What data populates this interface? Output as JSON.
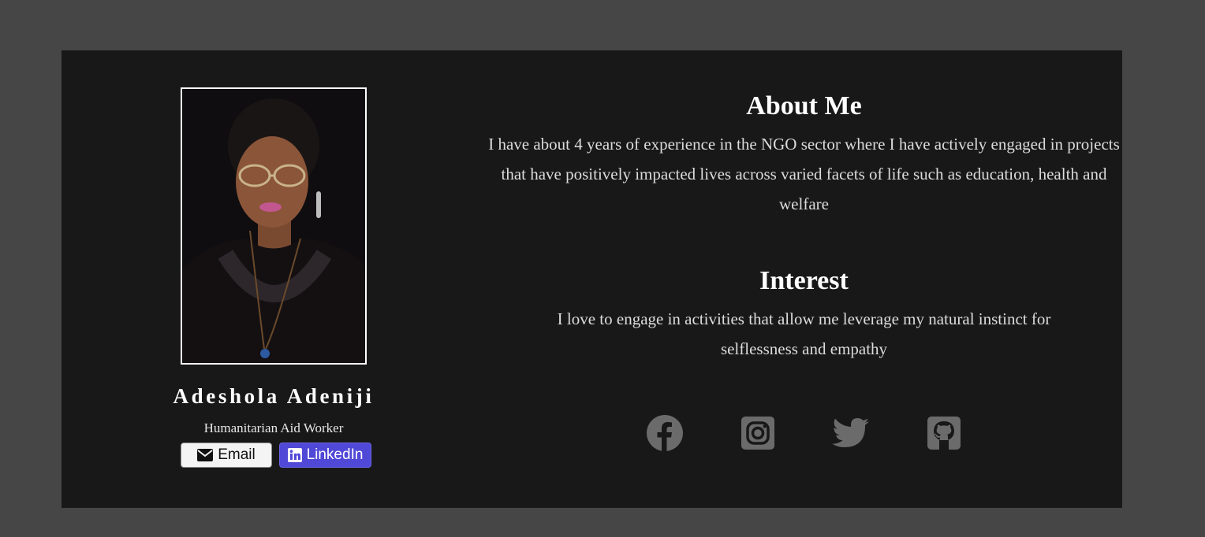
{
  "profile": {
    "name": "Adeshola Adeniji",
    "role": "Humanitarian Aid Worker",
    "email_label": "Email",
    "linkedin_label": "LinkedIn"
  },
  "about": {
    "title": "About Me",
    "text": "I have about 4 years of experience in the NGO sector where I have actively engaged in projects that have positively impacted lives across varied facets of life such as education, health and welfare"
  },
  "interest": {
    "title": "Interest",
    "text": "I love to engage in activities that allow me leverage my natural instinct for selflessness and empathy"
  },
  "socials": [
    {
      "icon": "facebook-icon"
    },
    {
      "icon": "instagram-icon"
    },
    {
      "icon": "twitter-icon"
    },
    {
      "icon": "github-icon"
    }
  ],
  "colors": {
    "page_bg": "#464646",
    "card_bg": "#181818",
    "linkedin_button": "#5048d6",
    "social_icon": "#6b6b6b"
  }
}
